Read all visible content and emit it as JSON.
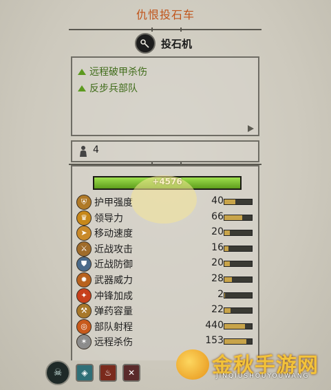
{
  "unit": {
    "title": "仇恨投石车",
    "class_label": "投石机",
    "class_icon": "catapult-icon"
  },
  "traits": [
    {
      "label": "远程破甲杀伤",
      "icon": "positive-triangle-icon"
    },
    {
      "label": "反步兵部队",
      "icon": "positive-triangle-icon"
    }
  ],
  "men": {
    "count": "4",
    "icon": "men-icon"
  },
  "health": {
    "value": "+4576",
    "fraction": 1.0
  },
  "stats": [
    {
      "name": "护甲强度",
      "value": "40",
      "fraction": 0.4,
      "icon": "armour-icon",
      "color": "#b07a28"
    },
    {
      "name": "领导力",
      "value": "66",
      "fraction": 0.66,
      "icon": "leadership-icon",
      "color": "#c7881a"
    },
    {
      "name": "移动速度",
      "value": "20",
      "fraction": 0.2,
      "icon": "speed-icon",
      "color": "#c98a2a"
    },
    {
      "name": "近战攻击",
      "value": "16",
      "fraction": 0.16,
      "icon": "melee-attack-icon",
      "color": "#a06c2a"
    },
    {
      "name": "近战防御",
      "value": "20",
      "fraction": 0.2,
      "icon": "melee-defence-icon",
      "color": "#4a6a8a"
    },
    {
      "name": "武器威力",
      "value": "28",
      "fraction": 0.28,
      "icon": "weapon-strength-icon",
      "color": "#b8621e"
    },
    {
      "name": "冲锋加成",
      "value": "2",
      "fraction": 0.02,
      "icon": "charge-bonus-icon",
      "color": "#c7401c"
    },
    {
      "name": "弹药容量",
      "value": "22",
      "fraction": 0.22,
      "icon": "ammunition-icon",
      "color": "#a8782a"
    },
    {
      "name": "部队射程",
      "value": "440",
      "fraction": 0.75,
      "icon": "range-icon",
      "color": "#c85a1c"
    },
    {
      "name": "远程杀伤",
      "value": "153",
      "fraction": 0.8,
      "icon": "missile-damage-icon",
      "color": "#8c8c8c"
    }
  ],
  "abilities": [
    {
      "icon": "skull-ability-icon"
    },
    {
      "icon": "shield-ability-icon",
      "color": "#2f6f77"
    },
    {
      "icon": "fire-ability-icon",
      "color": "#7a2a1c"
    },
    {
      "icon": "crossed-ability-icon",
      "color": "#5a2a2a"
    }
  ],
  "watermark": {
    "text": "金秋手游网",
    "sub": "JINQIUSHOUYOUWANG"
  }
}
